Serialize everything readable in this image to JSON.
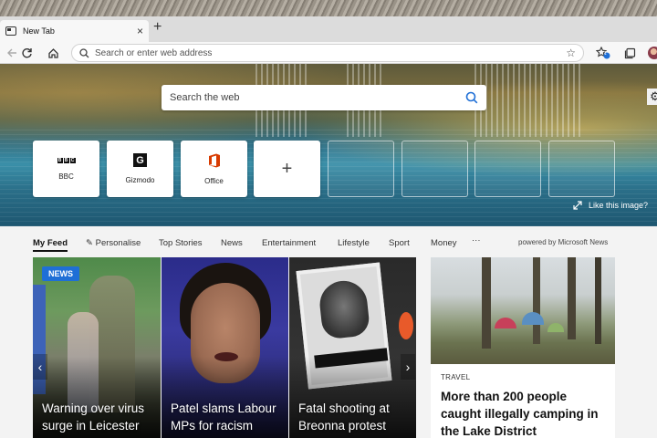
{
  "browser": {
    "tab_title": "New Tab",
    "tab_close": "×",
    "new_tab_button": "+",
    "address_placeholder": "Search or enter web address",
    "notification_count": "1"
  },
  "hero": {
    "search_placeholder": "Search the web",
    "like_image": "Like this image?",
    "tiles": [
      {
        "label": "BBC",
        "logo": [
          "B",
          "B",
          "C"
        ]
      },
      {
        "label": "Gizmodo",
        "logo": "G"
      },
      {
        "label": "Office"
      }
    ],
    "add_tile": "+"
  },
  "feed": {
    "nav": {
      "my_feed": "My Feed",
      "personalise": "Personalise",
      "top_stories": "Top Stories",
      "news": "News",
      "entertainment": "Entertainment",
      "lifestyle": "Lifestyle",
      "sport": "Sport",
      "money": "Money",
      "more": "···",
      "powered_by": "powered by Microsoft News"
    },
    "carousel": [
      {
        "badge": "NEWS",
        "title": "Warning over virus surge in Leicester"
      },
      {
        "title": "Patel slams Labour MPs for racism"
      },
      {
        "title": "Fatal shooting at Breonna protest"
      }
    ],
    "arrow_left": "‹",
    "arrow_right": "›",
    "travel_card": {
      "category": "TRAVEL",
      "title": "More than 200 people caught illegally camping in the Lake District"
    }
  },
  "colors": {
    "accent": "#1f6fd6",
    "office_orange": "#d83b01"
  }
}
